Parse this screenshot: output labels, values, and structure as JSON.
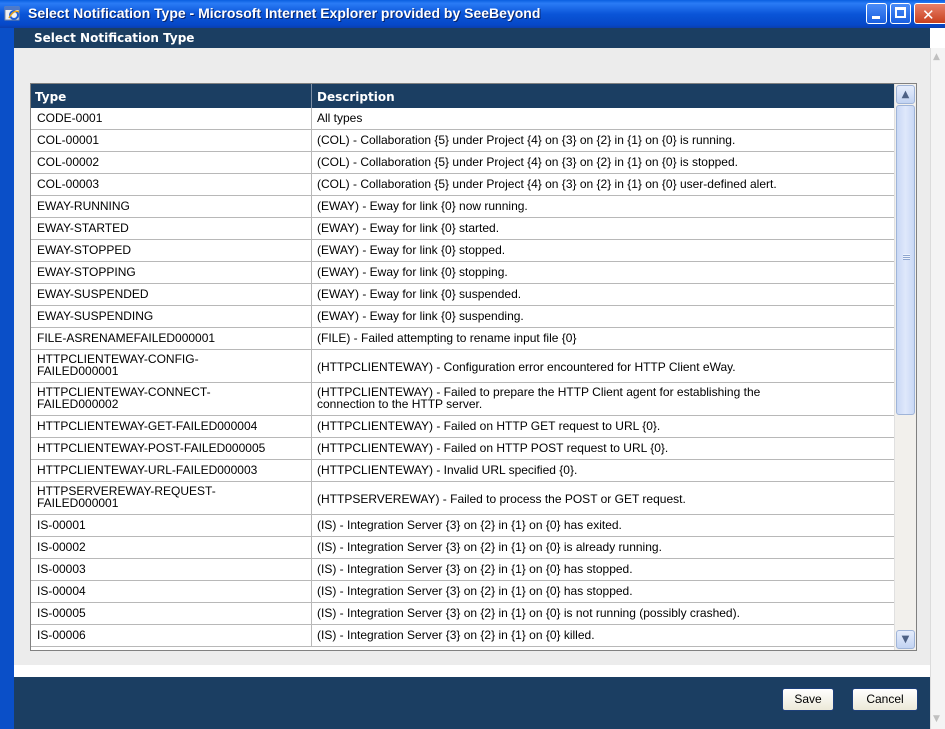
{
  "window": {
    "title": "Select Notification Type - Microsoft Internet Explorer provided by SeeBeyond",
    "close_glyph": "✕"
  },
  "dialog": {
    "header": "Select Notification Type"
  },
  "table": {
    "columns": [
      "Type",
      "Description"
    ],
    "rows": [
      {
        "type": "CODE-0001",
        "description": "All types"
      },
      {
        "type": "COL-00001",
        "description": "(COL) - Collaboration {5} under Project {4} on {3} on {2} in {1} on {0} is running."
      },
      {
        "type": "COL-00002",
        "description": "(COL) - Collaboration {5} under Project {4} on {3} on {2} in {1} on {0} is stopped."
      },
      {
        "type": "COL-00003",
        "description": "(COL) - Collaboration {5} under Project {4} on {3} on {2} in {1} on {0} user-defined alert."
      },
      {
        "type": "EWAY-RUNNING",
        "description": "(EWAY) - Eway for link {0} now running."
      },
      {
        "type": "EWAY-STARTED",
        "description": "(EWAY) - Eway for link {0} started."
      },
      {
        "type": "EWAY-STOPPED",
        "description": "(EWAY) - Eway for link {0} stopped."
      },
      {
        "type": "EWAY-STOPPING",
        "description": "(EWAY) - Eway for link {0} stopping."
      },
      {
        "type": "EWAY-SUSPENDED",
        "description": "(EWAY) - Eway for link {0} suspended."
      },
      {
        "type": "EWAY-SUSPENDING",
        "description": "(EWAY) - Eway for link {0} suspending."
      },
      {
        "type": "FILE-ASRENAMEFAILED000001",
        "description": "(FILE) - Failed attempting to rename input file {0}"
      },
      {
        "type": "HTTPCLIENTEWAY-CONFIG-FAILED000001",
        "type_line1": "HTTPCLIENTEWAY-CONFIG-",
        "type_line2": "FAILED000001",
        "description": "(HTTPCLIENTEWAY) - Configuration error encountered for HTTP Client eWay."
      },
      {
        "type": "HTTPCLIENTEWAY-CONNECT-FAILED000002",
        "type_line1": "HTTPCLIENTEWAY-CONNECT-",
        "type_line2": "FAILED000002",
        "description": "(HTTPCLIENTEWAY) - Failed to prepare the HTTP Client agent for establishing the connection to the HTTP server.",
        "desc_line1": "(HTTPCLIENTEWAY) - Failed to prepare the HTTP Client agent for establishing the",
        "desc_line2": "connection to the HTTP server."
      },
      {
        "type": "HTTPCLIENTEWAY-GET-FAILED000004",
        "description": "(HTTPCLIENTEWAY) - Failed on HTTP GET request to URL {0}."
      },
      {
        "type": "HTTPCLIENTEWAY-POST-FAILED000005",
        "description": "(HTTPCLIENTEWAY) - Failed on HTTP POST request to URL {0}."
      },
      {
        "type": "HTTPCLIENTEWAY-URL-FAILED000003",
        "description": "(HTTPCLIENTEWAY) - Invalid URL specified {0}."
      },
      {
        "type": "HTTPSERVEREWAY-REQUEST-FAILED000001",
        "type_line1": "HTTPSERVEREWAY-REQUEST-",
        "type_line2": "FAILED000001",
        "description": "(HTTPSERVEREWAY) - Failed to process the POST or GET request."
      },
      {
        "type": "IS-00001",
        "description": "(IS) - Integration Server {3} on {2} in {1} on {0} has exited."
      },
      {
        "type": "IS-00002",
        "description": "(IS) - Integration Server {3} on {2} in {1} on {0} is already running."
      },
      {
        "type": "IS-00003",
        "description": "(IS) - Integration Server {3} on {2} in {1} on {0} has stopped."
      },
      {
        "type": "IS-00004",
        "description": "(IS) - Integration Server {3} on {2} in {1} on {0} has stopped."
      },
      {
        "type": "IS-00005",
        "description": "(IS) - Integration Server {3} on {2} in {1} on {0} is not running (possibly crashed)."
      },
      {
        "type": "IS-00006",
        "description": "(IS) - Integration Server {3} on {2} in {1} on {0} killed."
      }
    ]
  },
  "buttons": {
    "save": "Save",
    "cancel": "Cancel"
  },
  "scrollbar": {
    "up": "▲",
    "down": "▼"
  }
}
